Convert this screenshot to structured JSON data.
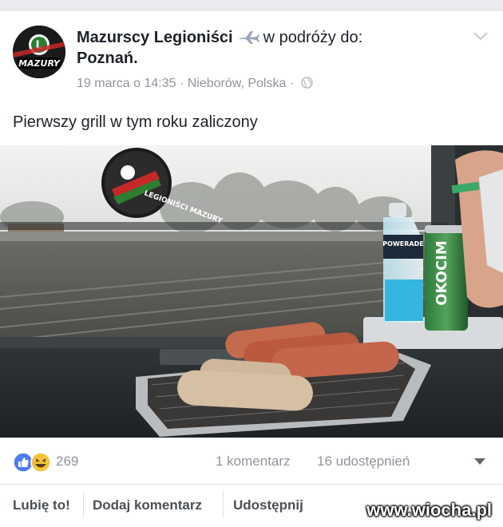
{
  "post": {
    "author": "Mazurscy Legioniści",
    "travel_text": "w podróży do:",
    "destination": "Poznań",
    "destination_suffix": ".",
    "date": "19 marca o 14:35",
    "separator": " · ",
    "location": "Nieborów, Polska",
    "text": "Pierwszy grill w tym roku zaliczony",
    "avatar_text": "MAZURY",
    "photo_sticker_text": "LEGIONIŚCI MAZURY",
    "can_brand": "OKOCIM",
    "bottle_brand": "POWERADE"
  },
  "stats": {
    "reactions_count": "269",
    "comments": "1 komentarz",
    "shares": "16 udostępnień"
  },
  "actions": {
    "like": "Lubię to!",
    "comment": "Dodaj komentarz",
    "share": "Udostępnij"
  },
  "watermark": "www.wiocha.pl",
  "icons": {
    "travel": "airplane-icon",
    "privacy": "globe-icon",
    "menu": "chevron-down-icon",
    "like": "like-icon",
    "haha": "haha-icon"
  },
  "colors": {
    "like_blue": "#4a7df0",
    "haha_yellow": "#f5c33b",
    "meta_gray": "#90949c"
  }
}
